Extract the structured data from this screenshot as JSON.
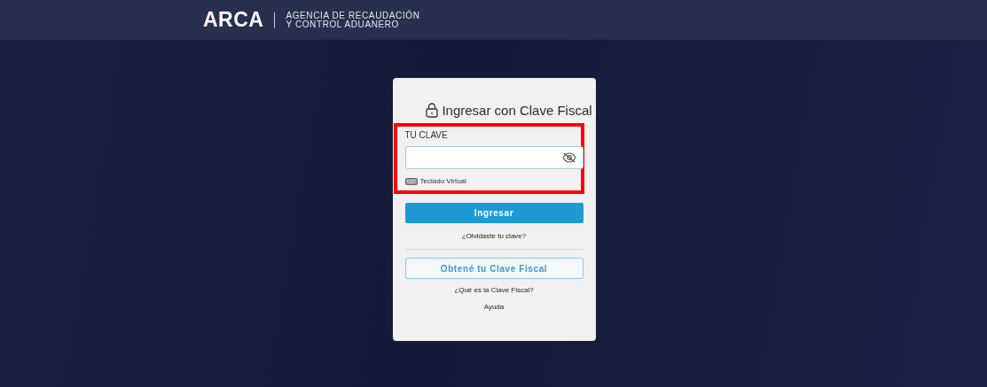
{
  "header": {
    "logo": "ARCA",
    "agency_line_1": "AGENCIA DE RECAUDACIÓN",
    "agency_line_2": "Y CONTROL ADUANERO"
  },
  "login_card": {
    "title": "Ingresar con Clave Fiscal",
    "password_section": {
      "highlighted": true,
      "label": "TU CLAVE",
      "password_visible": false,
      "virtual_keyboard": "Teclado Virtual"
    },
    "submit_button": "Ingresar",
    "forgot_link": "¿Olvidaste tu clave?",
    "get_key_button": "Obtené tu Clave Fiscal",
    "what_is_link": "¿Qué es la Clave Fiscal?",
    "help_link": "Ayuda"
  }
}
